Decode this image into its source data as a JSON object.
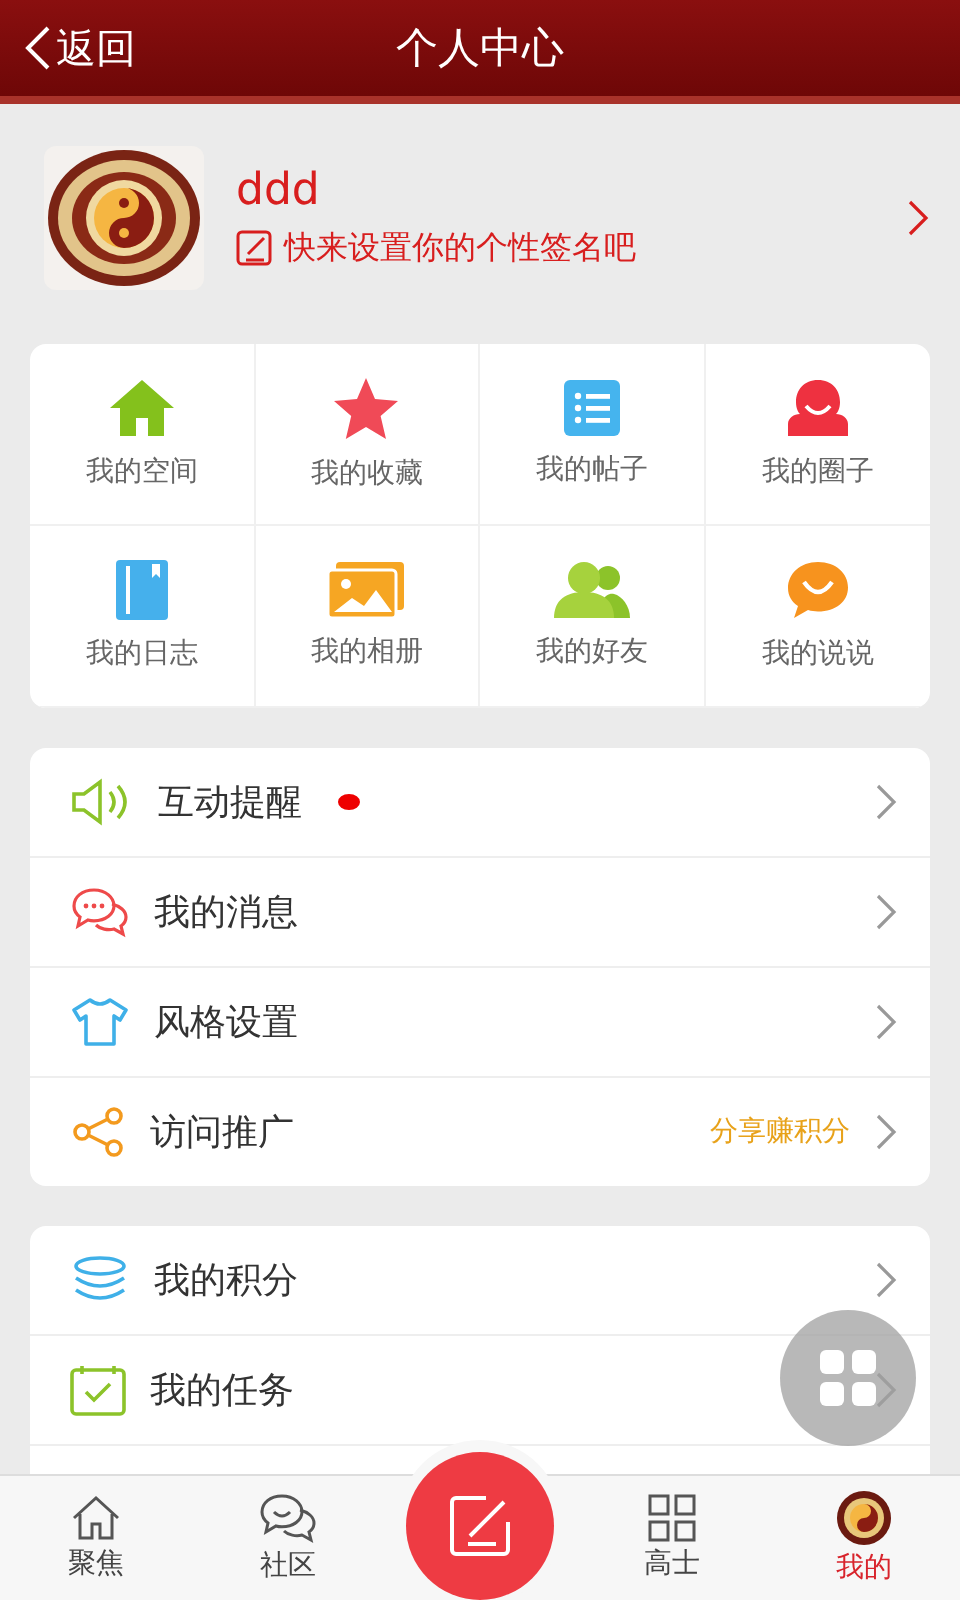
{
  "header": {
    "back": "返回",
    "title": "个人中心"
  },
  "profile": {
    "name": "ddd",
    "signature": "快来设置你的个性签名吧"
  },
  "grid": [
    {
      "label": "我的空间"
    },
    {
      "label": "我的收藏"
    },
    {
      "label": "我的帖子"
    },
    {
      "label": "我的圈子"
    },
    {
      "label": "我的日志"
    },
    {
      "label": "我的相册"
    },
    {
      "label": "我的好友"
    },
    {
      "label": "我的说说"
    }
  ],
  "menu_1": [
    {
      "label": "互动提醒",
      "dot": true
    },
    {
      "label": "我的消息",
      "dot": false
    },
    {
      "label": "风格设置",
      "dot": false
    },
    {
      "label": "访问推广",
      "dot": false,
      "note": "分享赚积分"
    }
  ],
  "menu_2": [
    {
      "label": "我的积分"
    },
    {
      "label": "我的任务"
    }
  ],
  "tab_bar": [
    {
      "label": "聚焦",
      "selected": false
    },
    {
      "label": "社区",
      "selected": false
    },
    {
      "kind": "compose"
    },
    {
      "label": "高士",
      "selected": false
    },
    {
      "label": "我的",
      "selected": true
    }
  ]
}
